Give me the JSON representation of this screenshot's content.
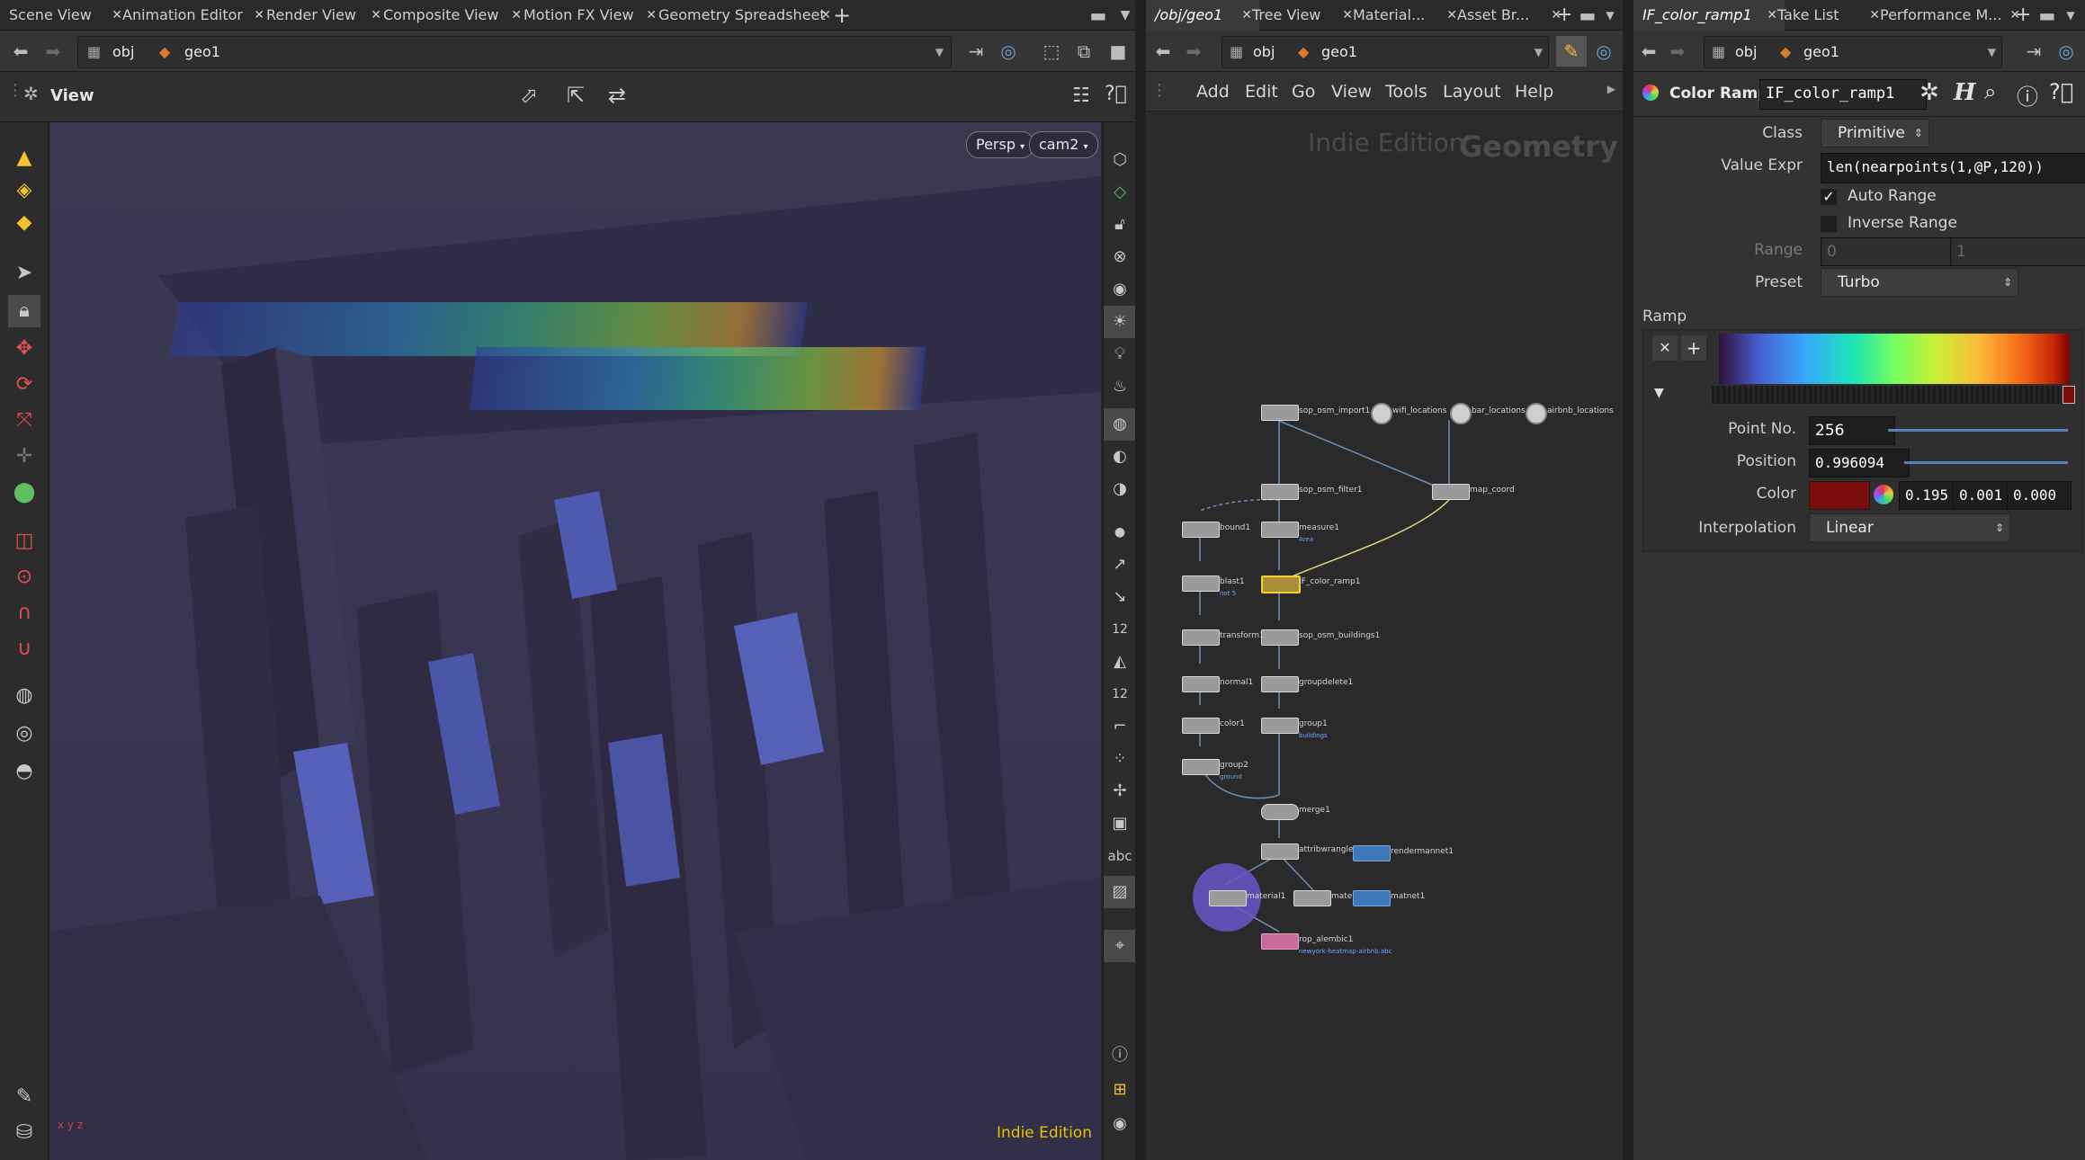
{
  "left_pane": {
    "tabs": [
      "Scene View",
      "Animation Editor",
      "Render View",
      "Composite View",
      "Motion FX View",
      "Geometry Spreadsheet"
    ],
    "path": {
      "root": "obj",
      "node": "geo1"
    },
    "view_title": "View",
    "camera_mode": "Persp",
    "camera_name": "cam2",
    "watermark": "Indie Edition",
    "axes_label": "x y z"
  },
  "network_pane": {
    "tabs": [
      "/obj/geo1",
      "Tree View",
      "Material...",
      "Asset Br..."
    ],
    "path": {
      "root": "obj",
      "node": "geo1"
    },
    "menu": [
      "Add",
      "Edit",
      "Go",
      "View",
      "Tools",
      "Layout",
      "Help"
    ],
    "watermark_edition": "Indie Edition",
    "watermark_context": "Geometry",
    "nodes": [
      {
        "name": "sop_osm_import1",
        "sub": ""
      },
      {
        "name": "wifi_locations",
        "sub": ""
      },
      {
        "name": "bar_locations",
        "sub": ""
      },
      {
        "name": "airbnb_locations",
        "sub": ""
      },
      {
        "name": "sop_osm_filter1",
        "sub": ""
      },
      {
        "name": "map_coord",
        "sub": ""
      },
      {
        "name": "bound1",
        "sub": ""
      },
      {
        "name": "measure1",
        "sub": "Area"
      },
      {
        "name": "blast1",
        "sub": "not 5"
      },
      {
        "name": "IF_color_ramp1",
        "sub": ""
      },
      {
        "name": "transform1",
        "sub": ""
      },
      {
        "name": "sop_osm_buildings1",
        "sub": ""
      },
      {
        "name": "normal1",
        "sub": ""
      },
      {
        "name": "groupdelete1",
        "sub": ""
      },
      {
        "name": "color1",
        "sub": ""
      },
      {
        "name": "group1",
        "sub": "buildings"
      },
      {
        "name": "group2",
        "sub": "ground"
      },
      {
        "name": "merge1",
        "sub": ""
      },
      {
        "name": "attribwrangle1",
        "sub": ""
      },
      {
        "name": "rendermannet1",
        "sub": ""
      },
      {
        "name": "material1",
        "sub": ""
      },
      {
        "name": "material2",
        "sub": ""
      },
      {
        "name": "matnet1",
        "sub": ""
      },
      {
        "name": "rop_alembic1",
        "sub": "newyork-heatmap-airbnb.abc"
      }
    ]
  },
  "param_pane": {
    "tabs": [
      "IF_color_ramp1",
      "Take List",
      "Performance M..."
    ],
    "path": {
      "root": "obj",
      "node": "geo1"
    },
    "node_type": "Color Ramp",
    "node_name": "IF_color_ramp1",
    "class_label": "Class",
    "class_value": "Primitive",
    "value_expr_label": "Value Expr",
    "value_expr": "len(nearpoints(1,@P,120))",
    "auto_range_label": "Auto Range",
    "auto_range": true,
    "inverse_range_label": "Inverse Range",
    "inverse_range": false,
    "range_label": "Range",
    "range_min": "0",
    "range_max": "1",
    "preset_label": "Preset",
    "preset_value": "Turbo",
    "ramp_label": "Ramp",
    "point_no_label": "Point No.",
    "point_no": "256",
    "position_label": "Position",
    "position": "0.996094",
    "color_label": "Color",
    "color_r": "0.195",
    "color_g": "0.001",
    "color_b": "0.000",
    "interpolation_label": "Interpolation",
    "interpolation": "Linear"
  },
  "colors": {
    "viewport_bg": "#3a3650",
    "accent_yellow": "#f2c230",
    "ramp_point_color": "#7a0c0c",
    "watermark_yellow": "#e6c200"
  }
}
